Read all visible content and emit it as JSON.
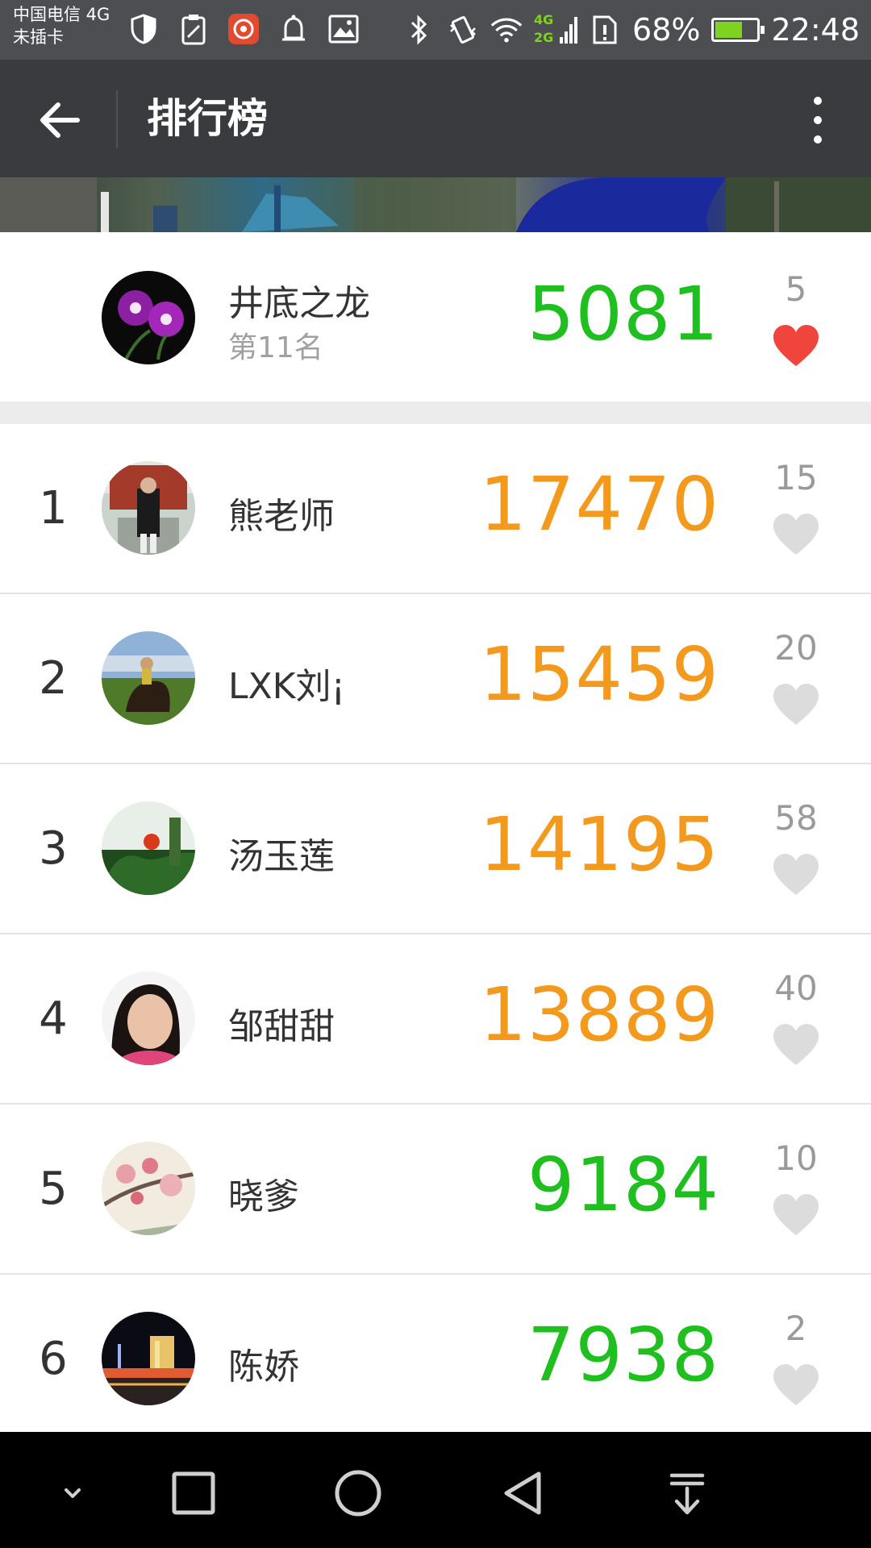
{
  "status_bar": {
    "carrier_line1": "中国电信 4G",
    "carrier_line2": "未插卡",
    "battery_percent": "68%",
    "battery_level": 0.68,
    "time": "22:48",
    "net_4g": "4G",
    "net_2g": "2G",
    "icons_left": [
      "shield-icon",
      "clipboard-icon",
      "app-notification-icon",
      "bell-icon",
      "image-icon"
    ],
    "icons_right": [
      "bluetooth-icon",
      "vibrate-icon",
      "wifi-icon",
      "signal-icon",
      "sim-alert-icon",
      "battery-icon"
    ]
  },
  "toolbar": {
    "title": "排行榜",
    "back_icon": "arrow-left-icon",
    "more_icon": "more-vertical-icon"
  },
  "my_entry": {
    "name": "井底之龙",
    "rank_text": "第11名",
    "score": "5081",
    "likes": "5",
    "liked": true
  },
  "rankings": [
    {
      "rank": "1",
      "name": "熊老师",
      "score": "17470",
      "likes": "15",
      "color": "orange"
    },
    {
      "rank": "2",
      "name": "LXK刘¡",
      "score": "15459",
      "likes": "20",
      "color": "orange"
    },
    {
      "rank": "3",
      "name": "汤玉莲",
      "score": "14195",
      "likes": "58",
      "color": "orange"
    },
    {
      "rank": "4",
      "name": "邹甜甜",
      "score": "13889",
      "likes": "40",
      "color": "orange"
    },
    {
      "rank": "5",
      "name": "晓爹",
      "score": "9184",
      "likes": "10",
      "color": "green"
    },
    {
      "rank": "6",
      "name": "陈娇",
      "score": "7938",
      "likes": "2",
      "color": "green"
    }
  ],
  "colors": {
    "green": "#1fbf1f",
    "orange": "#f39a1e",
    "heart_active": "#f0453c",
    "heart_inactive": "#dcdcdc",
    "toolbar_bg": "#3a3b3e",
    "status_bg": "#4d4e52"
  },
  "nav_bar": {
    "icons": [
      "chevron-down-icon",
      "recents-square-icon",
      "home-circle-icon",
      "back-triangle-icon",
      "pull-down-icon"
    ]
  }
}
